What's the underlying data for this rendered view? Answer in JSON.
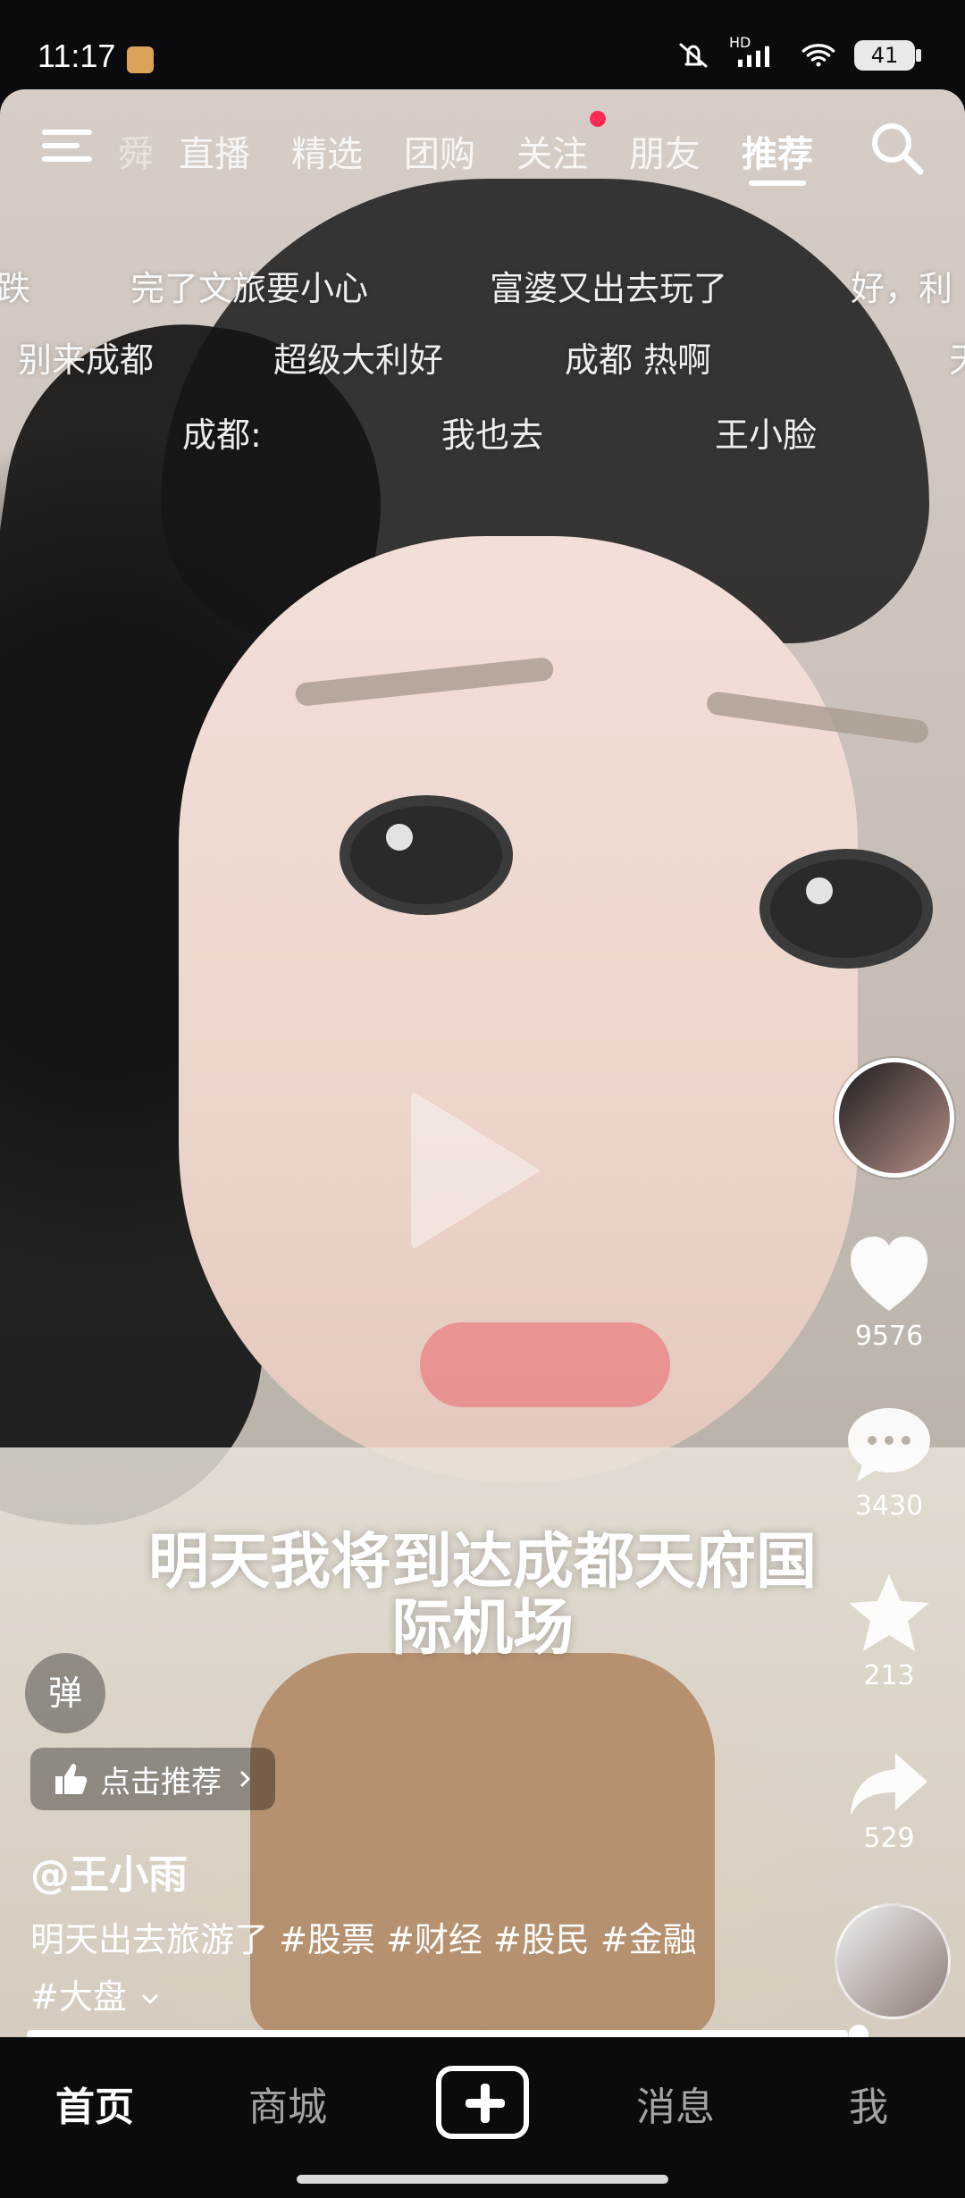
{
  "status_bar": {
    "time": "11:17",
    "network": "HD",
    "battery": "41"
  },
  "top_nav": {
    "partial_left": "舜",
    "tabs": [
      "直播",
      "精选",
      "团购",
      "关注",
      "朋友",
      "推荐"
    ],
    "active_tab": "推荐",
    "search_icon": "search-icon",
    "menu_icon": "hamburger-menu-icon",
    "dot_color": "#ff2b54"
  },
  "danmaku": {
    "row1": [
      "跌",
      "完了文旅要小心",
      "富婆又出去玩了",
      "好，利"
    ],
    "row2": [
      "别来成都",
      "超级大利好",
      "成都  热啊",
      "天"
    ],
    "row3": [
      "成都:",
      "我也去",
      "王小脸"
    ]
  },
  "right_rail": {
    "likes": "9576",
    "comments": "3430",
    "favorites": "213",
    "shares": "529"
  },
  "subtitle": {
    "line1": "明天我将到达成都天府国",
    "line2": "际机场"
  },
  "overlay": {
    "danmu_button": "弹",
    "recommend_label": "点击推荐",
    "author": "@王小雨",
    "description_line1": "明天出去旅游了 #股票 #财经 #股民 #金融",
    "description_line2": "#大盘"
  },
  "progress": {
    "value_percent": 99
  },
  "bottom_nav": {
    "items": [
      "首页",
      "商城",
      "消息",
      "我"
    ],
    "active": "首页"
  }
}
